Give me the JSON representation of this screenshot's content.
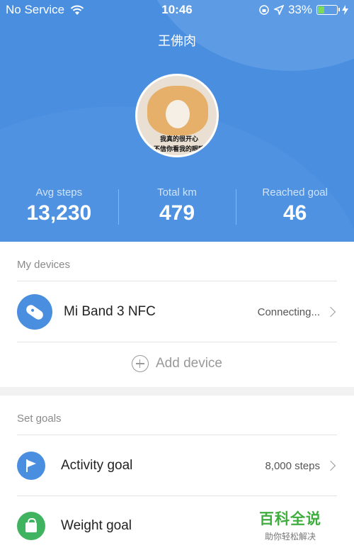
{
  "status_bar": {
    "carrier": "No Service",
    "time": "10:46",
    "battery_percent": "33%",
    "battery_level": 0.33,
    "icons": [
      "wifi-icon",
      "screen-lock-icon",
      "location-icon",
      "battery-icon",
      "charging-icon"
    ]
  },
  "profile": {
    "username": "王佛肉",
    "avatar_caption": [
      "我真的很开心",
      "不信你看我的眼睛"
    ]
  },
  "stats": [
    {
      "label": "Avg steps",
      "value": "13,230"
    },
    {
      "label": "Total km",
      "value": "479"
    },
    {
      "label": "Reached goal",
      "value": "46"
    }
  ],
  "devices": {
    "section_title": "My devices",
    "items": [
      {
        "name": "Mi Band 3 NFC",
        "status": "Connecting...",
        "icon": "band-icon"
      }
    ],
    "add_label": "Add device"
  },
  "goals": {
    "section_title": "Set goals",
    "items": [
      {
        "name": "Activity goal",
        "value": "8,000 steps",
        "icon": "flag-icon"
      },
      {
        "name": "Weight goal",
        "value": "",
        "icon": "weight-icon"
      }
    ]
  },
  "watermark": {
    "title": "百科全说",
    "subtitle": "助你轻松解决"
  },
  "colors": {
    "accent_blue": "#4a8ee0",
    "green": "#3fb35f",
    "battery_green": "#7ed957"
  }
}
